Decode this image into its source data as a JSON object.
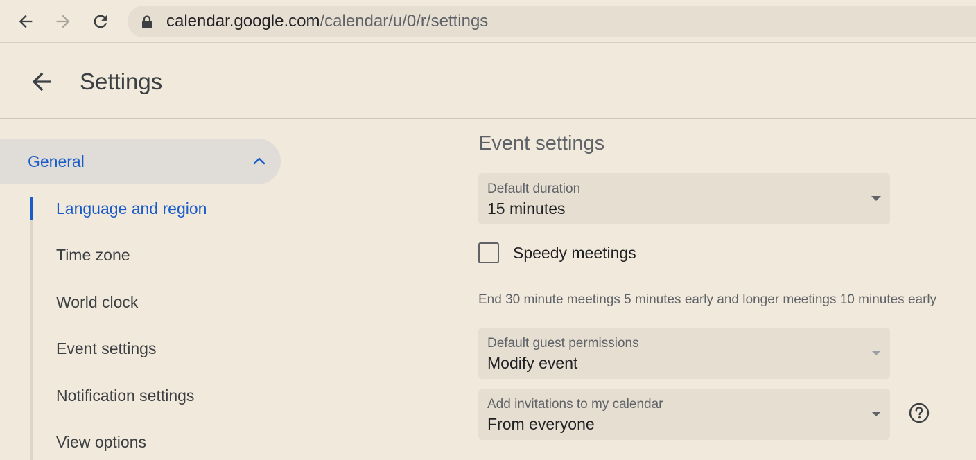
{
  "browser": {
    "url_host": "calendar.google.com",
    "url_path": "/calendar/u/0/r/settings",
    "icons": {
      "back": "arrow-left-icon",
      "forward": "arrow-right-icon",
      "reload": "reload-icon",
      "lock": "lock-icon"
    }
  },
  "header": {
    "title": "Settings",
    "back_icon": "arrow-left-icon"
  },
  "sidebar": {
    "section": {
      "label": "General",
      "expanded": true,
      "icon": "chevron-up-icon"
    },
    "items": [
      {
        "label": "Language and region",
        "active": true
      },
      {
        "label": "Time zone",
        "active": false
      },
      {
        "label": "World clock",
        "active": false
      },
      {
        "label": "Event settings",
        "active": false
      },
      {
        "label": "Notification settings",
        "active": false
      },
      {
        "label": "View options",
        "active": false
      }
    ]
  },
  "main": {
    "section_title": "Event settings",
    "default_duration": {
      "label": "Default duration",
      "value": "15 minutes"
    },
    "speedy_meetings": {
      "label": "Speedy meetings",
      "checked": false
    },
    "speedy_helper": "End 30 minute meetings 5 minutes early and longer meetings 10 minutes early",
    "guest_permissions": {
      "label": "Default guest permissions",
      "value": "Modify event"
    },
    "add_invitations": {
      "label": "Add invitations to my calendar",
      "value": "From everyone"
    },
    "help_icon": "help-circle-icon"
  },
  "colors": {
    "background": "#f1e9dc",
    "accent": "#1a5cc8",
    "field_bg": "#e6ded1",
    "active_nav_bg": "#e0ddd8"
  }
}
